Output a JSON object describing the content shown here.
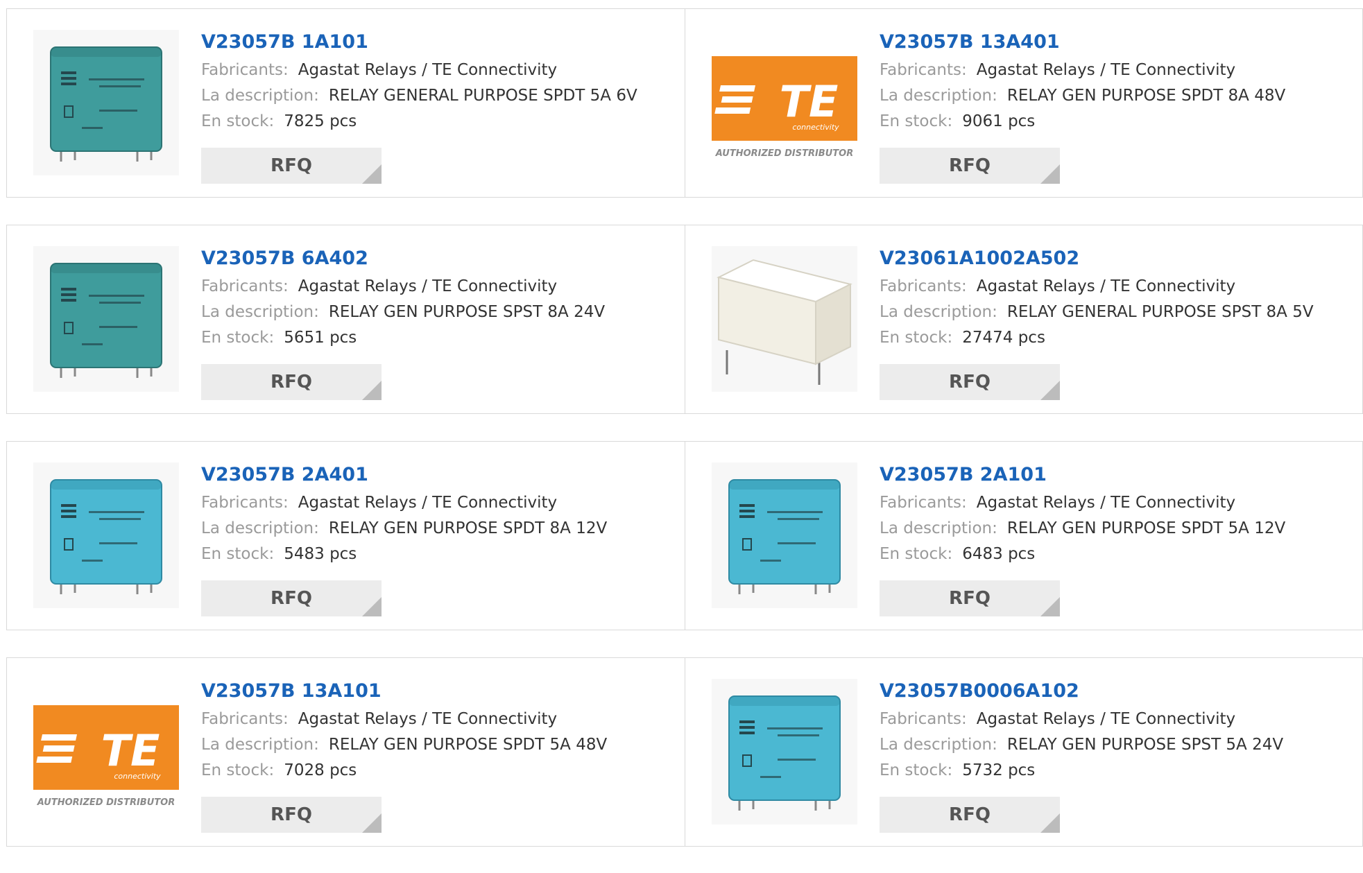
{
  "labels": {
    "manufacturer": "Fabricants:",
    "description": "La description:",
    "stock": "En stock:",
    "rfq": "RFQ"
  },
  "colors": {
    "link": "#1a63b8",
    "te_orange": "#f18a21",
    "relay_teal": "#3f9c9c",
    "relay_cyan": "#4bb8d2",
    "relay_white": "#f2efe4"
  },
  "logo": {
    "brand": "TE",
    "sub": "connectivity",
    "tagline": "AUTHORIZED DISTRIBUTOR"
  },
  "products": [
    {
      "part": "V23057B 1A101",
      "manufacturer": "Agastat Relays / TE Connectivity",
      "description": "RELAY GENERAL PURPOSE SPDT 5A 6V",
      "stock": "7825 pcs",
      "image": "relay-teal-photo"
    },
    {
      "part": "V23057B 13A401",
      "manufacturer": "Agastat Relays / TE Connectivity",
      "description": "RELAY GEN PURPOSE SPDT 8A 48V",
      "stock": "9061 pcs",
      "image": "te-logo"
    },
    {
      "part": "V23057B 6A402",
      "manufacturer": "Agastat Relays / TE Connectivity",
      "description": "RELAY GEN PURPOSE SPST 8A 24V",
      "stock": "5651 pcs",
      "image": "relay-teal-photo"
    },
    {
      "part": "V23061A1002A502",
      "manufacturer": "Agastat Relays / TE Connectivity",
      "description": "RELAY GENERAL PURPOSE SPST 8A 5V",
      "stock": "27474 pcs",
      "image": "relay-white-photo"
    },
    {
      "part": "V23057B 2A401",
      "manufacturer": "Agastat Relays / TE Connectivity",
      "description": "RELAY GEN PURPOSE SPDT 8A 12V",
      "stock": "5483 pcs",
      "image": "relay-cyan-photo"
    },
    {
      "part": "V23057B 2A101",
      "manufacturer": "Agastat Relays / TE Connectivity",
      "description": "RELAY GEN PURPOSE SPDT 5A 12V",
      "stock": "6483 pcs",
      "image": "relay-cyan-photo"
    },
    {
      "part": "V23057B 13A101",
      "manufacturer": "Agastat Relays / TE Connectivity",
      "description": "RELAY GEN PURPOSE SPDT 5A 48V",
      "stock": "7028 pcs",
      "image": "te-logo"
    },
    {
      "part": "V23057B0006A102",
      "manufacturer": "Agastat Relays / TE Connectivity",
      "description": "RELAY GEN PURPOSE SPST 5A 24V",
      "stock": "5732 pcs",
      "image": "relay-cyan-photo"
    }
  ]
}
